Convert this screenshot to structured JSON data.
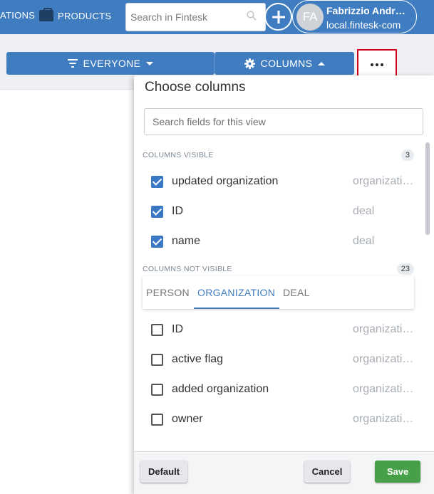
{
  "nav": {
    "apps_label": "ATIONS",
    "products_label": "PRODUCTS",
    "search_placeholder": "Search in Fintesk",
    "user": {
      "initials": "FA",
      "name": "Fabrizzio Andr…",
      "domain": "local.fintesk-com"
    }
  },
  "toolbar": {
    "everyone_label": "EVERYONE",
    "columns_label": "COLUMNS"
  },
  "panel": {
    "title": "Choose columns",
    "field_search_placeholder": "Search fields for this view",
    "visible_section": {
      "label": "COLUMNS VISIBLE",
      "count": "3",
      "items": [
        {
          "name": "updated organization",
          "entity": "organization",
          "checked": true
        },
        {
          "name": "ID",
          "entity": "deal",
          "checked": true
        },
        {
          "name": "name",
          "entity": "deal",
          "checked": true
        }
      ]
    },
    "not_visible_section": {
      "label": "COLUMNS NOT VISIBLE",
      "count": "23",
      "tabs": [
        {
          "label": "PERSON",
          "active": false
        },
        {
          "label": "ORGANIZATION",
          "active": true
        },
        {
          "label": "DEAL",
          "active": false
        }
      ],
      "items": [
        {
          "name": "ID",
          "entity": "organization",
          "checked": false
        },
        {
          "name": "active flag",
          "entity": "organization",
          "checked": false
        },
        {
          "name": "added organization",
          "entity": "organization",
          "checked": false
        },
        {
          "name": "owner",
          "entity": "organization",
          "checked": false
        }
      ]
    },
    "footer": {
      "default_label": "Default",
      "cancel_label": "Cancel",
      "save_label": "Save"
    }
  },
  "colors": {
    "primary": "#3f7cc0",
    "highlight_border": "#d0021b",
    "save": "#46a049"
  }
}
